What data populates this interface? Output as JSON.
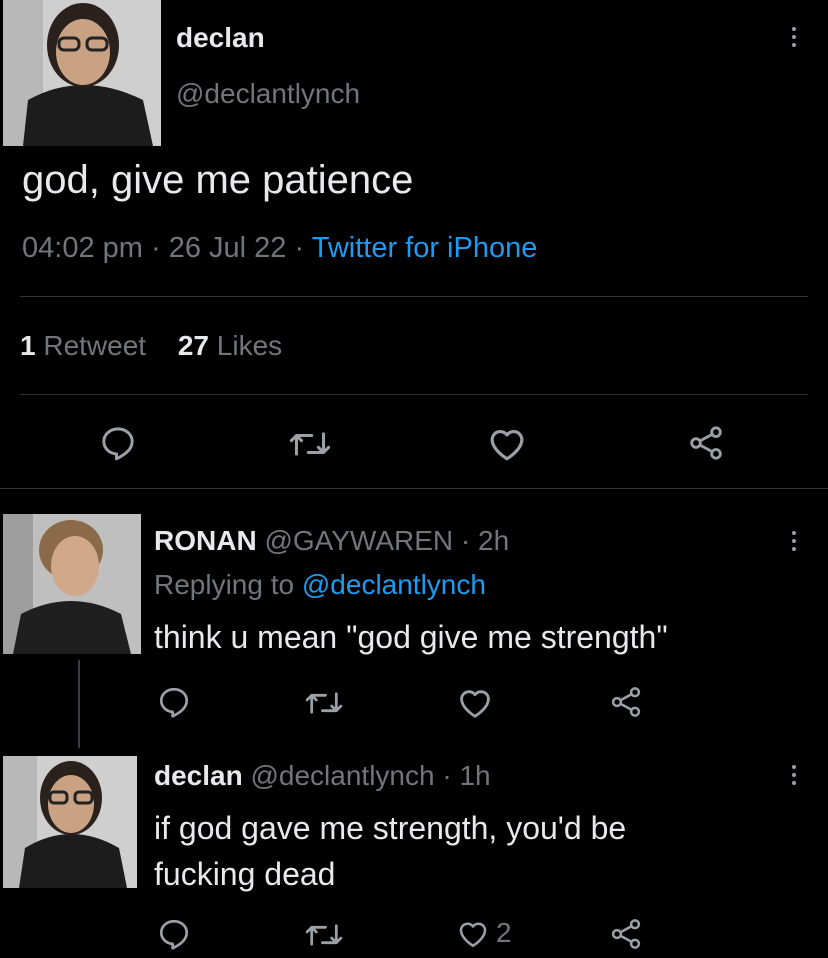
{
  "main_tweet": {
    "author": {
      "name": "declan",
      "handle": "@declantlynch"
    },
    "text": "god, give me patience",
    "time": "04:02 pm",
    "date": "26 Jul 22",
    "source": "Twitter for iPhone",
    "separator": "·",
    "stats": {
      "retweets_count": "1",
      "retweets_label": "Retweet",
      "likes_count": "27",
      "likes_label": "Likes"
    }
  },
  "replies": [
    {
      "name": "RONAN",
      "handle": "@GAYWAREN",
      "time": "2h",
      "replying_prefix": "Replying to",
      "replying_handle": "@declantlynch",
      "text": "think u mean \"god give me strength\""
    },
    {
      "name": "declan",
      "handle": "@declantlynch",
      "time": "1h",
      "line1": "if god gave me strength, you'd be",
      "line2": "fucking dead",
      "like_count": "2"
    }
  ],
  "icons": {
    "reply": "reply-icon",
    "retweet": "retweet-icon",
    "like": "heart-icon",
    "share": "share-icon",
    "more": "more-icon"
  },
  "colors": {
    "background": "#000000",
    "text": "#e7e9ea",
    "secondary": "#71767b",
    "link": "#1d9bf0",
    "divider": "#2f3336"
  }
}
